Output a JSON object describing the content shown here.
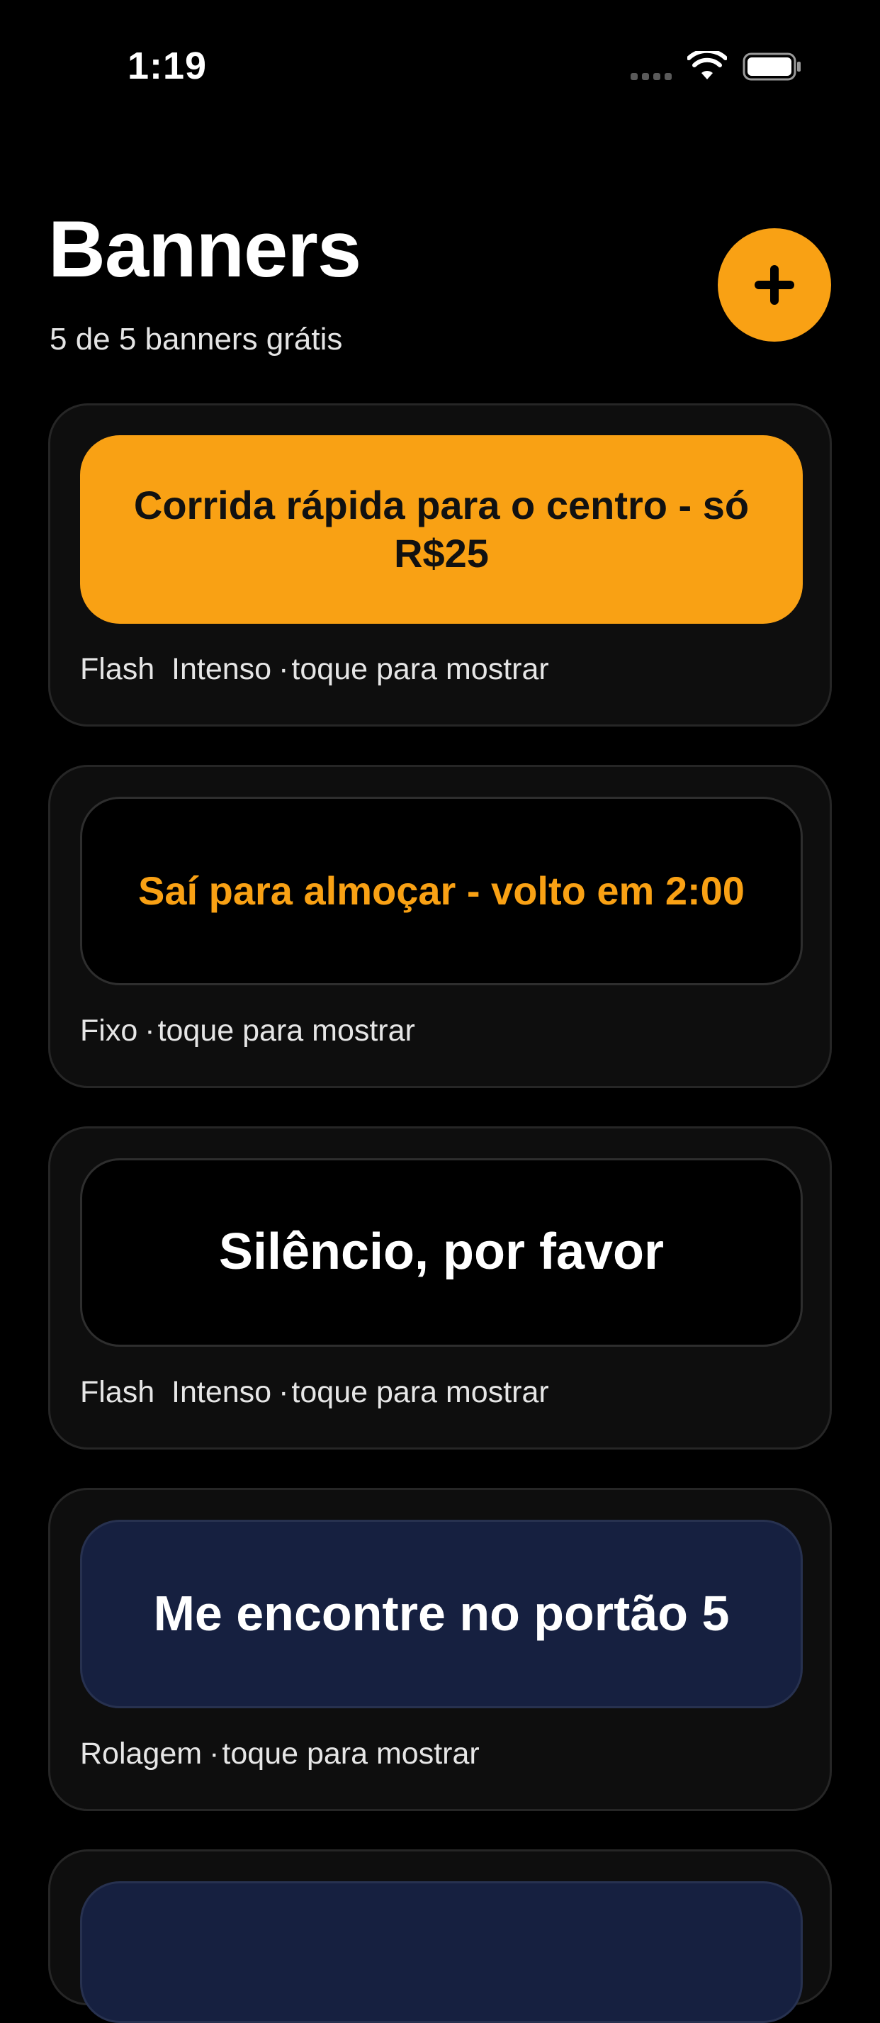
{
  "status_bar": {
    "time": "1:19",
    "icons": [
      "cellular-icon",
      "wifi-icon",
      "battery-icon"
    ]
  },
  "header": {
    "title": "Banners",
    "subtitle": "5 de 5 banners grátis",
    "add_icon": "plus-icon"
  },
  "colors": {
    "accent": "#f9a114",
    "background": "#000000",
    "card_background": "#0e0e0e",
    "navy_banner": "#162040"
  },
  "banners": [
    {
      "text": "Corrida rápida para o centro - só R$25",
      "mode": "Flash  Intenso",
      "action": "toque para mostrar",
      "background": "#f9a114",
      "text_color": "#111111"
    },
    {
      "text": "Saí para almoçar - volto em 2:00",
      "mode": "Fixo",
      "action": "toque para mostrar",
      "background": "#000000",
      "text_color": "#f9a114"
    },
    {
      "text": "Silêncio, por favor",
      "mode": "Flash  Intenso",
      "action": "toque para mostrar",
      "background": "#000000",
      "text_color": "#ffffff"
    },
    {
      "text": "Me encontre no portão 5",
      "mode": "Rolagem",
      "action": "toque para mostrar",
      "background": "#162040",
      "text_color": "#ffffff"
    },
    {
      "background": "#162040"
    }
  ],
  "separator": "·"
}
